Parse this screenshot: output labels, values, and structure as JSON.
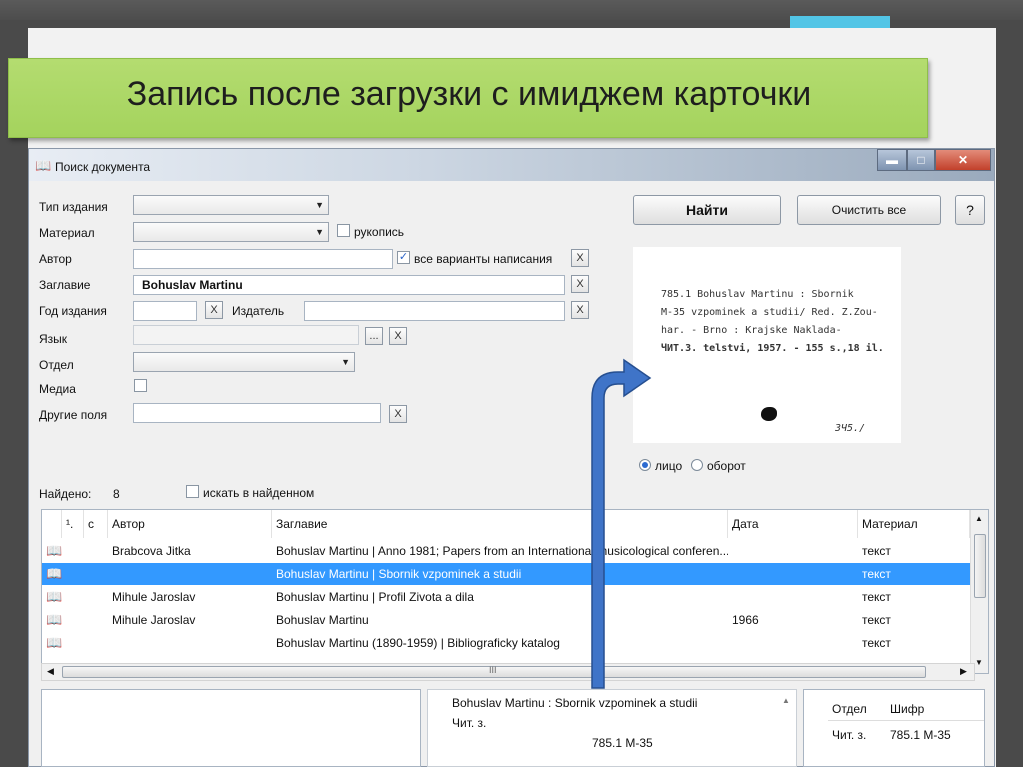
{
  "slide": {
    "title": "Запись после загрузки  с имиджем карточки"
  },
  "window": {
    "title": "Поиск документа",
    "icons": {
      "app": "book-icon",
      "minimize": "minimize-icon",
      "maximize": "maximize-icon",
      "close": "close-icon"
    }
  },
  "form": {
    "type_label": "Тип издания",
    "material_label": "Материал",
    "manuscript_label": "рукопись",
    "author_label": "Автор",
    "author_value": "",
    "all_variants_label": "все варианты написания",
    "title_label": "Заглавие",
    "title_value": "Bohuslav Martinu",
    "year_label": "Год издания",
    "publisher_label": "Издатель",
    "language_label": "Язык",
    "department_label": "Отдел",
    "media_label": "Медиа",
    "other_fields_label": "Другие поля",
    "clear_glyph": "X",
    "more_glyph": "...",
    "check_glyph": "✓"
  },
  "buttons": {
    "find": "Найти",
    "clear_all": "Очистить все",
    "help": "?"
  },
  "card": {
    "lines": [
      "785.1     Bohuslav Martinu : Sbornik",
      "M-35   vzpominek a studii/ Red. Z.Zou-",
      "          har. - Brno : Krajske Naklada-",
      "ЧИТ.З.   telstvi, 1957. - 155 s.,18 il."
    ],
    "footnote": "ЗЧ5./"
  },
  "side": {
    "front": "лицо",
    "back": "оборот"
  },
  "results": {
    "found_label": "Найдено:",
    "found_count": "8",
    "search_in_found": "искать в найденном",
    "columns": {
      "num": "¹.",
      "c": "с",
      "author": "Автор",
      "title": "Заглавие",
      "date": "Дата",
      "material": "Материал"
    },
    "rows": [
      {
        "author": "Brabcova Jitka",
        "title": "Bohuslav Martinu | Anno 1981; Papers from an International musicological conferen...",
        "date": "",
        "material": "текст"
      },
      {
        "author": "",
        "title": "Bohuslav Martinu | Sbornik vzpominek a studii",
        "date": "",
        "material": "текст"
      },
      {
        "author": "Mihule Jaroslav",
        "title": "Bohuslav Martinu | Profil Zivota a dila",
        "date": "",
        "material": "текст"
      },
      {
        "author": "Mihule Jaroslav",
        "title": "Bohuslav Martinu",
        "date": "1966",
        "material": "текст"
      },
      {
        "author": "",
        "title": "Bohuslav Martinu (1890-1959) | Bibliograficky katalog",
        "date": "",
        "material": "текст"
      }
    ],
    "scroll_mid": "III"
  },
  "detail": {
    "line1": "Bohuslav Martinu : Sbornik vzpominek a studii",
    "line2": "Чит. з.",
    "line3": "785.1 M-35"
  },
  "holdings": {
    "col1": "Отдел",
    "col2": "Шифр",
    "row_dept": "Чит. з.",
    "row_code": "785.1 M-35"
  },
  "colors": {
    "banner": "#a8d460",
    "accent": "#52c5e6",
    "selection": "#3399ff",
    "arrow": "#3f74c8"
  }
}
